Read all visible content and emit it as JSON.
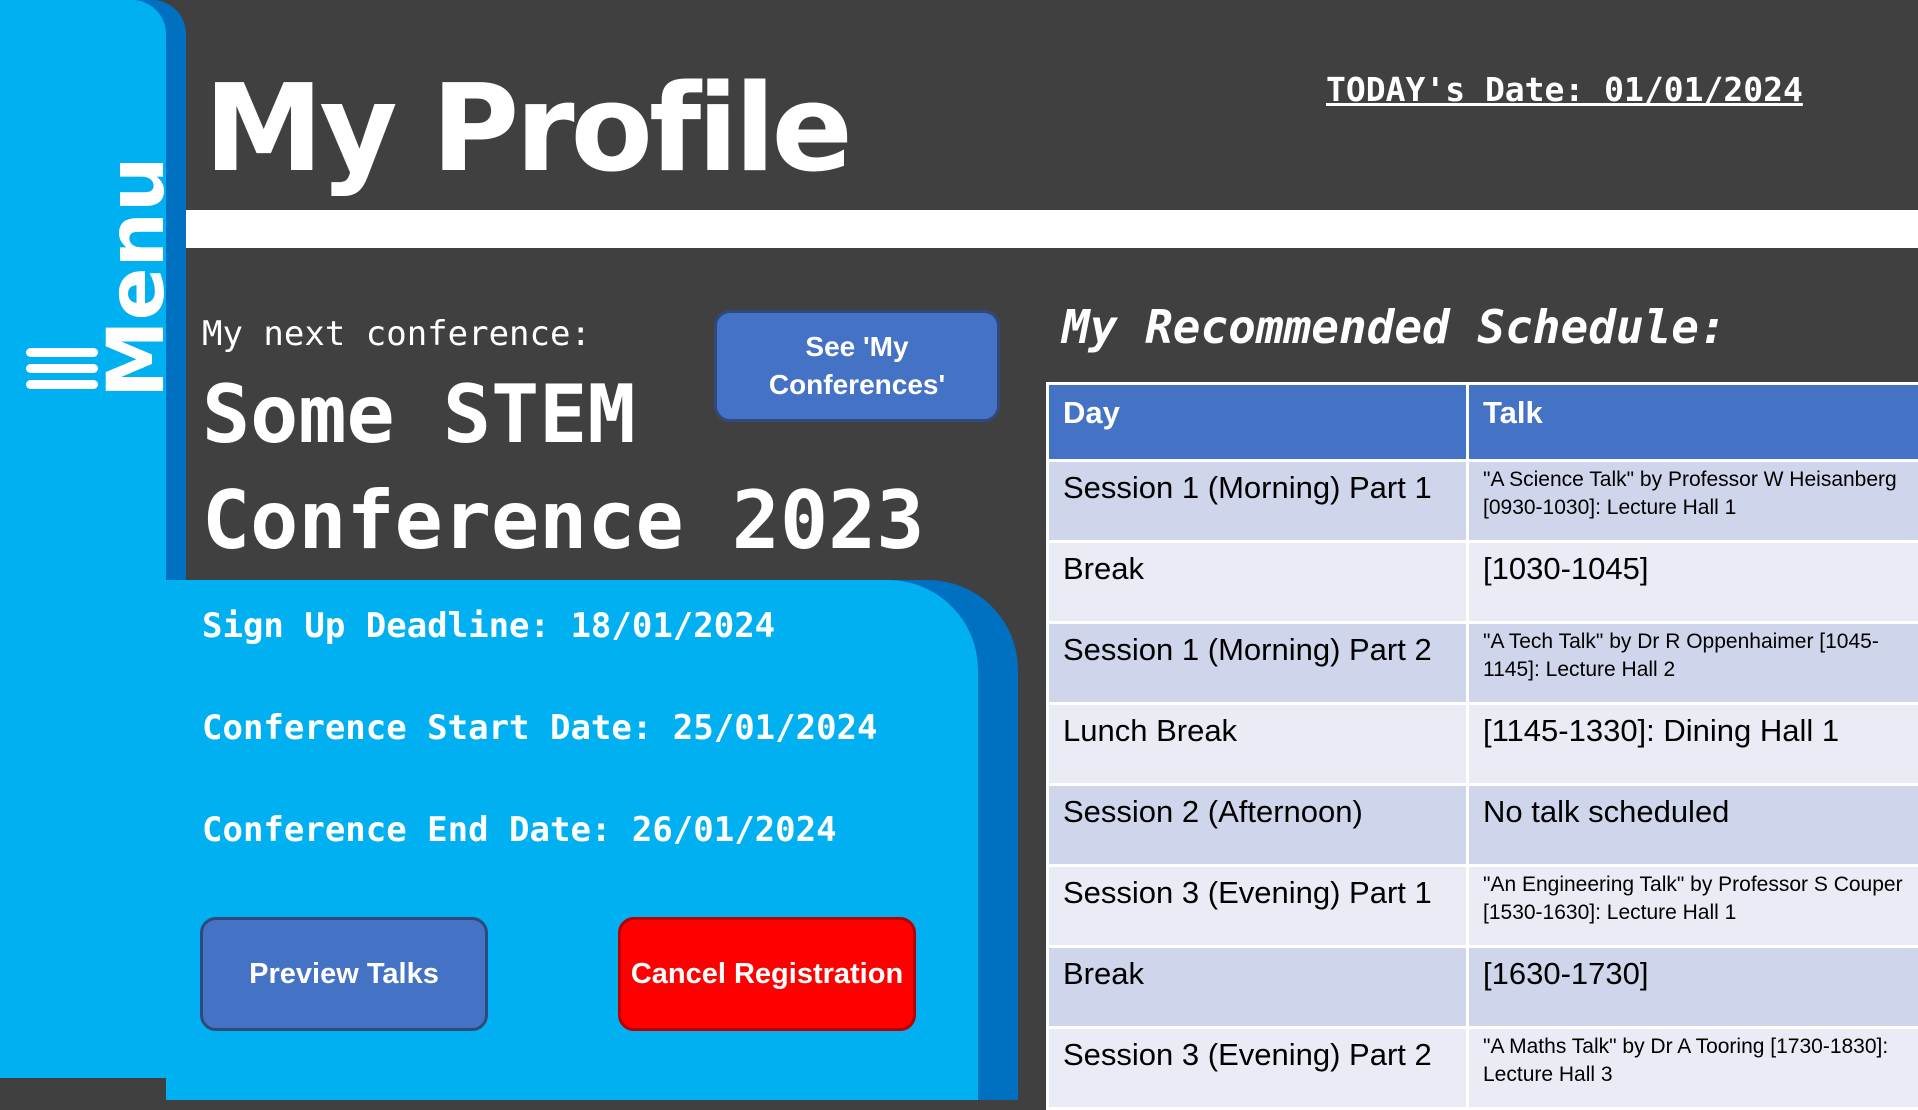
{
  "menu": {
    "label": "Menu",
    "icon": "hamburger-icon"
  },
  "header": {
    "title": "My Profile",
    "today": "TODAY's Date: 01/01/2024"
  },
  "next_conference": {
    "label": "My next conference:",
    "name": "Some STEM Conference 2023",
    "see_button": "See 'My Conferences'",
    "signup": "Sign Up Deadline: 18/01/2024",
    "start": "Conference Start Date: 25/01/2024",
    "end": "Conference End Date: 26/01/2024",
    "preview_button": "Preview Talks",
    "cancel_button": "Cancel Registration"
  },
  "schedule": {
    "title": "My Recommended Schedule:",
    "headers": [
      "Day",
      "Talk"
    ],
    "rows": [
      {
        "day": "Session 1 (Morning) Part 1",
        "talk": "\"A Science Talk\" by Professor W Heisanberg [0930-1030]: Lecture Hall 1"
      },
      {
        "day": "Break",
        "talk": "[1030-1045]"
      },
      {
        "day": "Session 1 (Morning) Part 2",
        "talk": "\"A Tech Talk\" by Dr R Oppenhaimer [1045-1145]: Lecture Hall 2"
      },
      {
        "day": "Lunch Break",
        "talk": "[1145-1330]: Dining Hall 1"
      },
      {
        "day": "Session 2 (Afternoon)",
        "talk": "No talk scheduled"
      },
      {
        "day": "Session 3 (Evening) Part 1",
        "talk": "\"An Engineering Talk\" by Professor S Couper [1530-1630]: Lecture Hall 1"
      },
      {
        "day": "Break",
        "talk": "[1630-1730]"
      },
      {
        "day": "Session 3 (Evening) Part 2",
        "talk": "\"A Maths Talk\" by Dr A Tooring [1730-1830]: Lecture Hall 3"
      }
    ]
  },
  "colors": {
    "background": "#404040",
    "menu": "#00b0f0",
    "menu_shadow": "#0070c0",
    "button_blue": "#4472c4",
    "button_red": "#ff0000",
    "row_dark": "#cfd5ea",
    "row_light": "#e9ebf5"
  }
}
